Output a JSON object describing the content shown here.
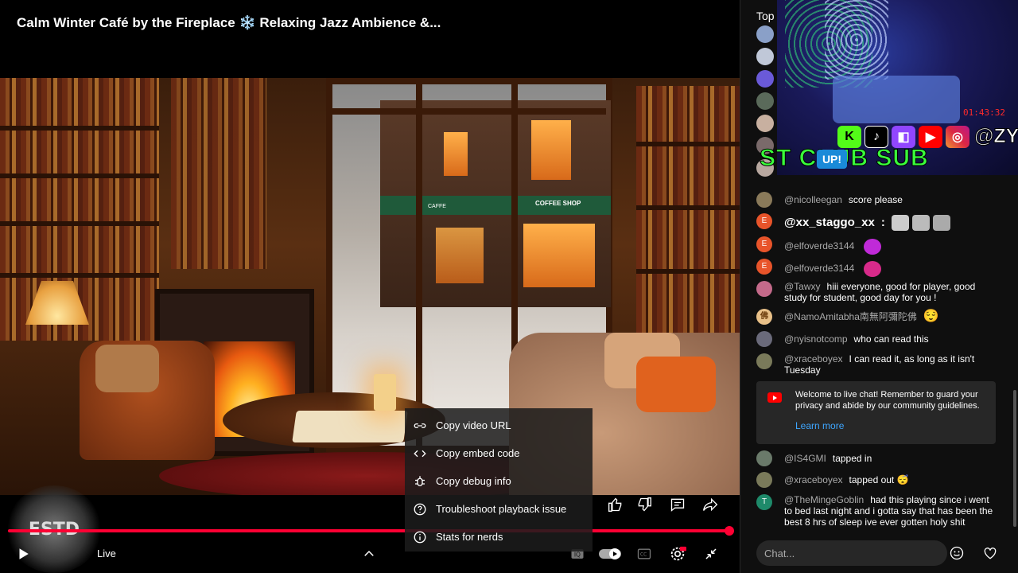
{
  "video": {
    "title": "Calm Winter Café by the Fireplace ❄️ Relaxing Jazz Ambience &...",
    "live_label": "Live",
    "shop_sign": "COFFEE SHOP",
    "cafe_sign": "CAFFE",
    "logo_text": "ESTD"
  },
  "context_menu": {
    "items": [
      {
        "label": "Copy video URL",
        "icon": "link-icon"
      },
      {
        "label": "Copy embed code",
        "icon": "code-icon"
      },
      {
        "label": "Copy debug info",
        "icon": "debug-icon"
      },
      {
        "label": "Troubleshoot playback issue",
        "icon": "question-icon"
      },
      {
        "label": "Stats for nerds",
        "icon": "info-icon"
      }
    ]
  },
  "chat": {
    "top_label": "Top",
    "overlay": {
      "timer": "01:43:32",
      "handle": "@ZYIROH",
      "sub_text": "ST CLUB SUB",
      "up_label": "UP!"
    },
    "messages": [
      {
        "author": "@nicolleegan",
        "text": "score please",
        "avatar_color": "#8a7a5a",
        "avatar_letter": ""
      },
      {
        "author": "@xx_staggo_xx",
        "text": ":",
        "avatar_color": "#e8542a",
        "avatar_letter": "E"
      },
      {
        "author": "@elfoverde3144",
        "text": "",
        "avatar_color": "#e8542a",
        "avatar_letter": "E"
      },
      {
        "author": "@elfoverde3144",
        "text": "",
        "avatar_color": "#e8542a",
        "avatar_letter": "E"
      },
      {
        "author": "@Tawxy",
        "text": "hiii everyone, good for player, good study for student, good day for you !",
        "avatar_color": "#c46a8a",
        "avatar_letter": ""
      },
      {
        "author": "@NamoAmitabha南無阿彌陀佛",
        "text": "😌",
        "avatar_color": "#e8c088",
        "avatar_letter": "佛"
      },
      {
        "author": "@nyisnotcomp",
        "text": "who can read this",
        "avatar_color": "#6a6a7a",
        "avatar_letter": ""
      },
      {
        "author": "@xraceboyex",
        "text": "I can read it, as long as it isn't Tuesday",
        "avatar_color": "#7a7a5a",
        "avatar_letter": ""
      },
      {
        "author": "@IS4GMI",
        "text": "tapped in",
        "avatar_color": "#6a7a6a",
        "avatar_letter": ""
      },
      {
        "author": "@xraceboyex",
        "text": "tapped out 😴",
        "avatar_color": "#7a7a5a",
        "avatar_letter": ""
      },
      {
        "author": "@TheMingeGoblin",
        "text": "had this playing since i went to bed last night and i gotta say that has been the best 8 hrs of sleep ive ever gotten holy shit",
        "avatar_color": "#1e8a6a",
        "avatar_letter": "T"
      }
    ],
    "welcome": {
      "text": "Welcome to live chat! Remember to guard your privacy and abide by our community guidelines.",
      "link": "Learn more"
    },
    "input_placeholder": "Chat..."
  }
}
